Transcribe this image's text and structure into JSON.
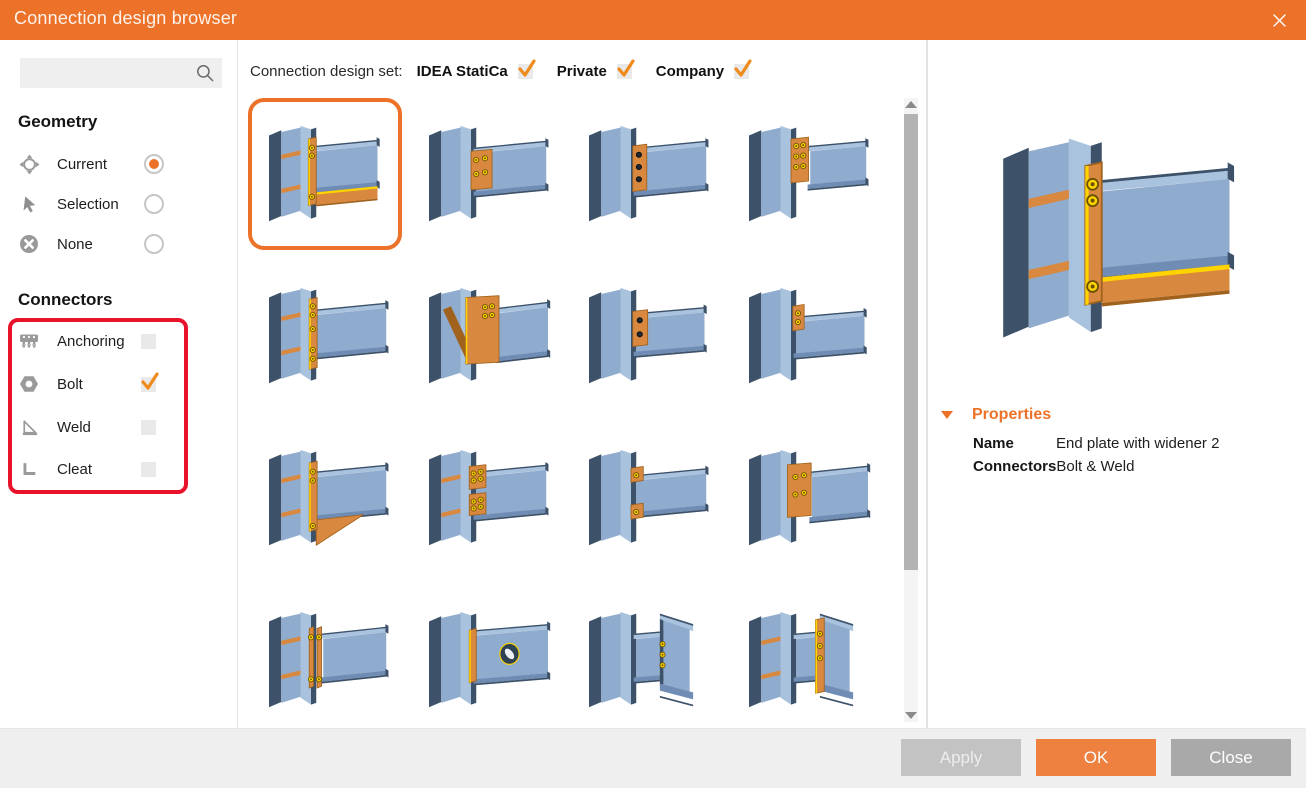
{
  "window": {
    "title": "Connection design browser",
    "close_icon": "✕"
  },
  "sidebar": {
    "search_placeholder": "",
    "geometry": {
      "heading": "Geometry",
      "options": [
        {
          "label": "Current",
          "icon": "target-icon",
          "selected": true
        },
        {
          "label": "Selection",
          "icon": "cursor-icon",
          "selected": false
        },
        {
          "label": "None",
          "icon": "circle-cross-icon",
          "selected": false
        }
      ]
    },
    "connectors": {
      "heading": "Connectors",
      "highlight_color": "#e8132b",
      "options": [
        {
          "label": "Anchoring",
          "icon": "anchoring-icon",
          "checked": false
        },
        {
          "label": "Bolt",
          "icon": "bolt-icon",
          "checked": true
        },
        {
          "label": "Weld",
          "icon": "weld-icon",
          "checked": false
        },
        {
          "label": "Cleat",
          "icon": "cleat-icon",
          "checked": false
        }
      ]
    }
  },
  "main": {
    "design_set": {
      "label": "Connection design set:",
      "options": [
        {
          "label": "IDEA StatiCa",
          "checked": true
        },
        {
          "label": "Private",
          "checked": true
        },
        {
          "label": "Company",
          "checked": true
        }
      ]
    },
    "thumbnails": [
      {
        "variant": "end-plate-with-widener",
        "selected": true
      },
      {
        "variant": "bolted-flange-plate",
        "selected": false
      },
      {
        "variant": "fin-plate-3-bolts",
        "selected": false
      },
      {
        "variant": "end-plate-6-bolts",
        "selected": false
      },
      {
        "variant": "extended-end-plate",
        "selected": false
      },
      {
        "variant": "haunch-plate-diagonal",
        "selected": false
      },
      {
        "variant": "fin-plate-2-bolts",
        "selected": false
      },
      {
        "variant": "fin-plate-small",
        "selected": false
      },
      {
        "variant": "triangular-haunch",
        "selected": false
      },
      {
        "variant": "bolted-splice-plates",
        "selected": false
      },
      {
        "variant": "top-bottom-plates",
        "selected": false
      },
      {
        "variant": "wide-end-plate",
        "selected": false
      },
      {
        "variant": "end-plate-strips",
        "selected": false
      },
      {
        "variant": "web-opening",
        "selected": false
      },
      {
        "variant": "beam-to-beam-bolted",
        "selected": false
      },
      {
        "variant": "beam-to-beam-end-plate",
        "selected": false
      }
    ]
  },
  "right": {
    "preview_variant": "end-plate-with-widener",
    "properties": {
      "heading": "Properties",
      "rows": [
        {
          "label": "Name",
          "value": "End plate with widener 2"
        },
        {
          "label": "Connectors",
          "value": "Bolt & Weld"
        }
      ]
    }
  },
  "footer": {
    "apply_label": "Apply",
    "ok_label": "OK",
    "close_label": "Close"
  },
  "colors": {
    "accent": "#ed7229",
    "ok_button": "#ee8140",
    "highlight_red": "#e8132b"
  }
}
